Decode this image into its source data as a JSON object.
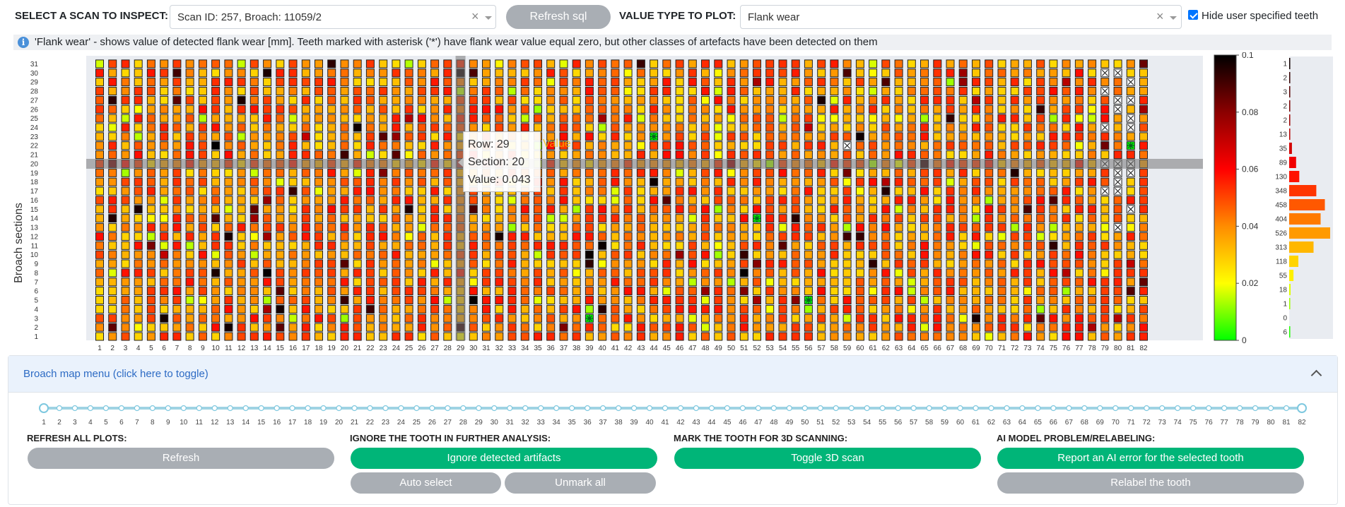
{
  "header": {
    "scan_label": "SELECT A SCAN TO INSPECT:",
    "scan_value": "Scan ID: 257, Broach: 11059/2",
    "refresh_sql": "Refresh sql",
    "value_type_label": "VALUE TYPE TO PLOT:",
    "value_type_value": "Flank wear",
    "hide_user_label": "Hide user specified teeth",
    "hide_user_checked": true
  },
  "info": {
    "text": "'Flank wear' - shows value of detected flank wear [mm]. Teeth marked with asterisk ('*') have flank wear value equal zero, but other classes of artefacts have been detected on them"
  },
  "chart_data": {
    "type": "heatmap",
    "ylabel": "Broach sections",
    "x_ticks": [
      1,
      2,
      3,
      4,
      5,
      6,
      7,
      8,
      9,
      10,
      11,
      12,
      13,
      14,
      15,
      16,
      17,
      18,
      19,
      20,
      21,
      22,
      23,
      24,
      25,
      26,
      27,
      28,
      29,
      30,
      31,
      32,
      33,
      34,
      35,
      36,
      37,
      38,
      39,
      40,
      41,
      42,
      43,
      44,
      45,
      46,
      47,
      48,
      49,
      50,
      51,
      52,
      53,
      54,
      55,
      56,
      57,
      58,
      59,
      60,
      61,
      62,
      63,
      64,
      65,
      66,
      67,
      68,
      69,
      70,
      71,
      72,
      73,
      74,
      75,
      76,
      77,
      78,
      79,
      80,
      81,
      82
    ],
    "y_ticks": [
      1,
      2,
      3,
      4,
      5,
      6,
      7,
      8,
      9,
      10,
      11,
      12,
      13,
      14,
      15,
      16,
      17,
      18,
      19,
      20,
      21,
      22,
      23,
      24,
      25,
      26,
      27,
      28,
      29,
      30,
      31
    ],
    "colorbar": {
      "min": 0,
      "max": 0.1,
      "ticks": [
        "0",
        "0.02",
        "0.04",
        "0.06",
        "0.08",
        "0.1"
      ],
      "colors": [
        "#00ff00",
        "#ffff00",
        "#ff8c00",
        "#ff0000",
        "#8b0000",
        "#000000"
      ]
    },
    "asterisk_cells": [
      [
        44,
        23
      ],
      [
        52,
        14
      ],
      [
        39,
        3
      ],
      [
        56,
        5
      ],
      [
        81,
        22
      ]
    ],
    "x_cells": [
      [
        79,
        30
      ],
      [
        80,
        30
      ],
      [
        81,
        29
      ],
      [
        79,
        28
      ],
      [
        80,
        27
      ],
      [
        81,
        27
      ],
      [
        80,
        26
      ],
      [
        81,
        25
      ],
      [
        79,
        24
      ],
      [
        81,
        24
      ],
      [
        59,
        22
      ],
      [
        79,
        20
      ],
      [
        80,
        20
      ],
      [
        81,
        20
      ],
      [
        80,
        19
      ],
      [
        81,
        19
      ],
      [
        80,
        18
      ],
      [
        79,
        17
      ],
      [
        80,
        17
      ],
      [
        81,
        15
      ],
      [
        80,
        13
      ]
    ],
    "histogram": {
      "labels": [
        "1",
        "2",
        "3",
        "2",
        "2",
        "13",
        "35",
        "89",
        "130",
        "348",
        "458",
        "404",
        "526",
        "313",
        "118",
        "55",
        "18",
        "1",
        "0",
        "6"
      ],
      "counts": [
        1,
        2,
        3,
        2,
        2,
        13,
        35,
        89,
        130,
        348,
        458,
        404,
        526,
        313,
        118,
        55,
        18,
        1,
        0,
        6
      ]
    },
    "highlight": {
      "column": 29,
      "row": 20
    }
  },
  "tooltip": {
    "row": "Row: 29",
    "section": "Section: 20",
    "value": "Value: 0.043",
    "ghost": "Value"
  },
  "menu": {
    "toggle_text": "Broach map menu (click here to toggle)",
    "slider_min": 1,
    "slider_max": 82,
    "sections": [
      {
        "title": "REFRESH ALL PLOTS:"
      },
      {
        "title": "IGNORE THE TOOTH IN FURTHER ANALYSIS:"
      },
      {
        "title": "MARK THE TOOTH FOR 3D SCANNING:"
      },
      {
        "title": "AI MODEL PROBLEM/RELABELING:"
      }
    ],
    "buttons": {
      "refresh": "Refresh",
      "ignore": "Ignore detected artifacts",
      "auto_select": "Auto select",
      "unmark_all": "Unmark all",
      "toggle3d": "Toggle 3D scan",
      "report_ai": "Report an AI error for the selected tooth",
      "relabel": "Relabel the tooth"
    }
  }
}
